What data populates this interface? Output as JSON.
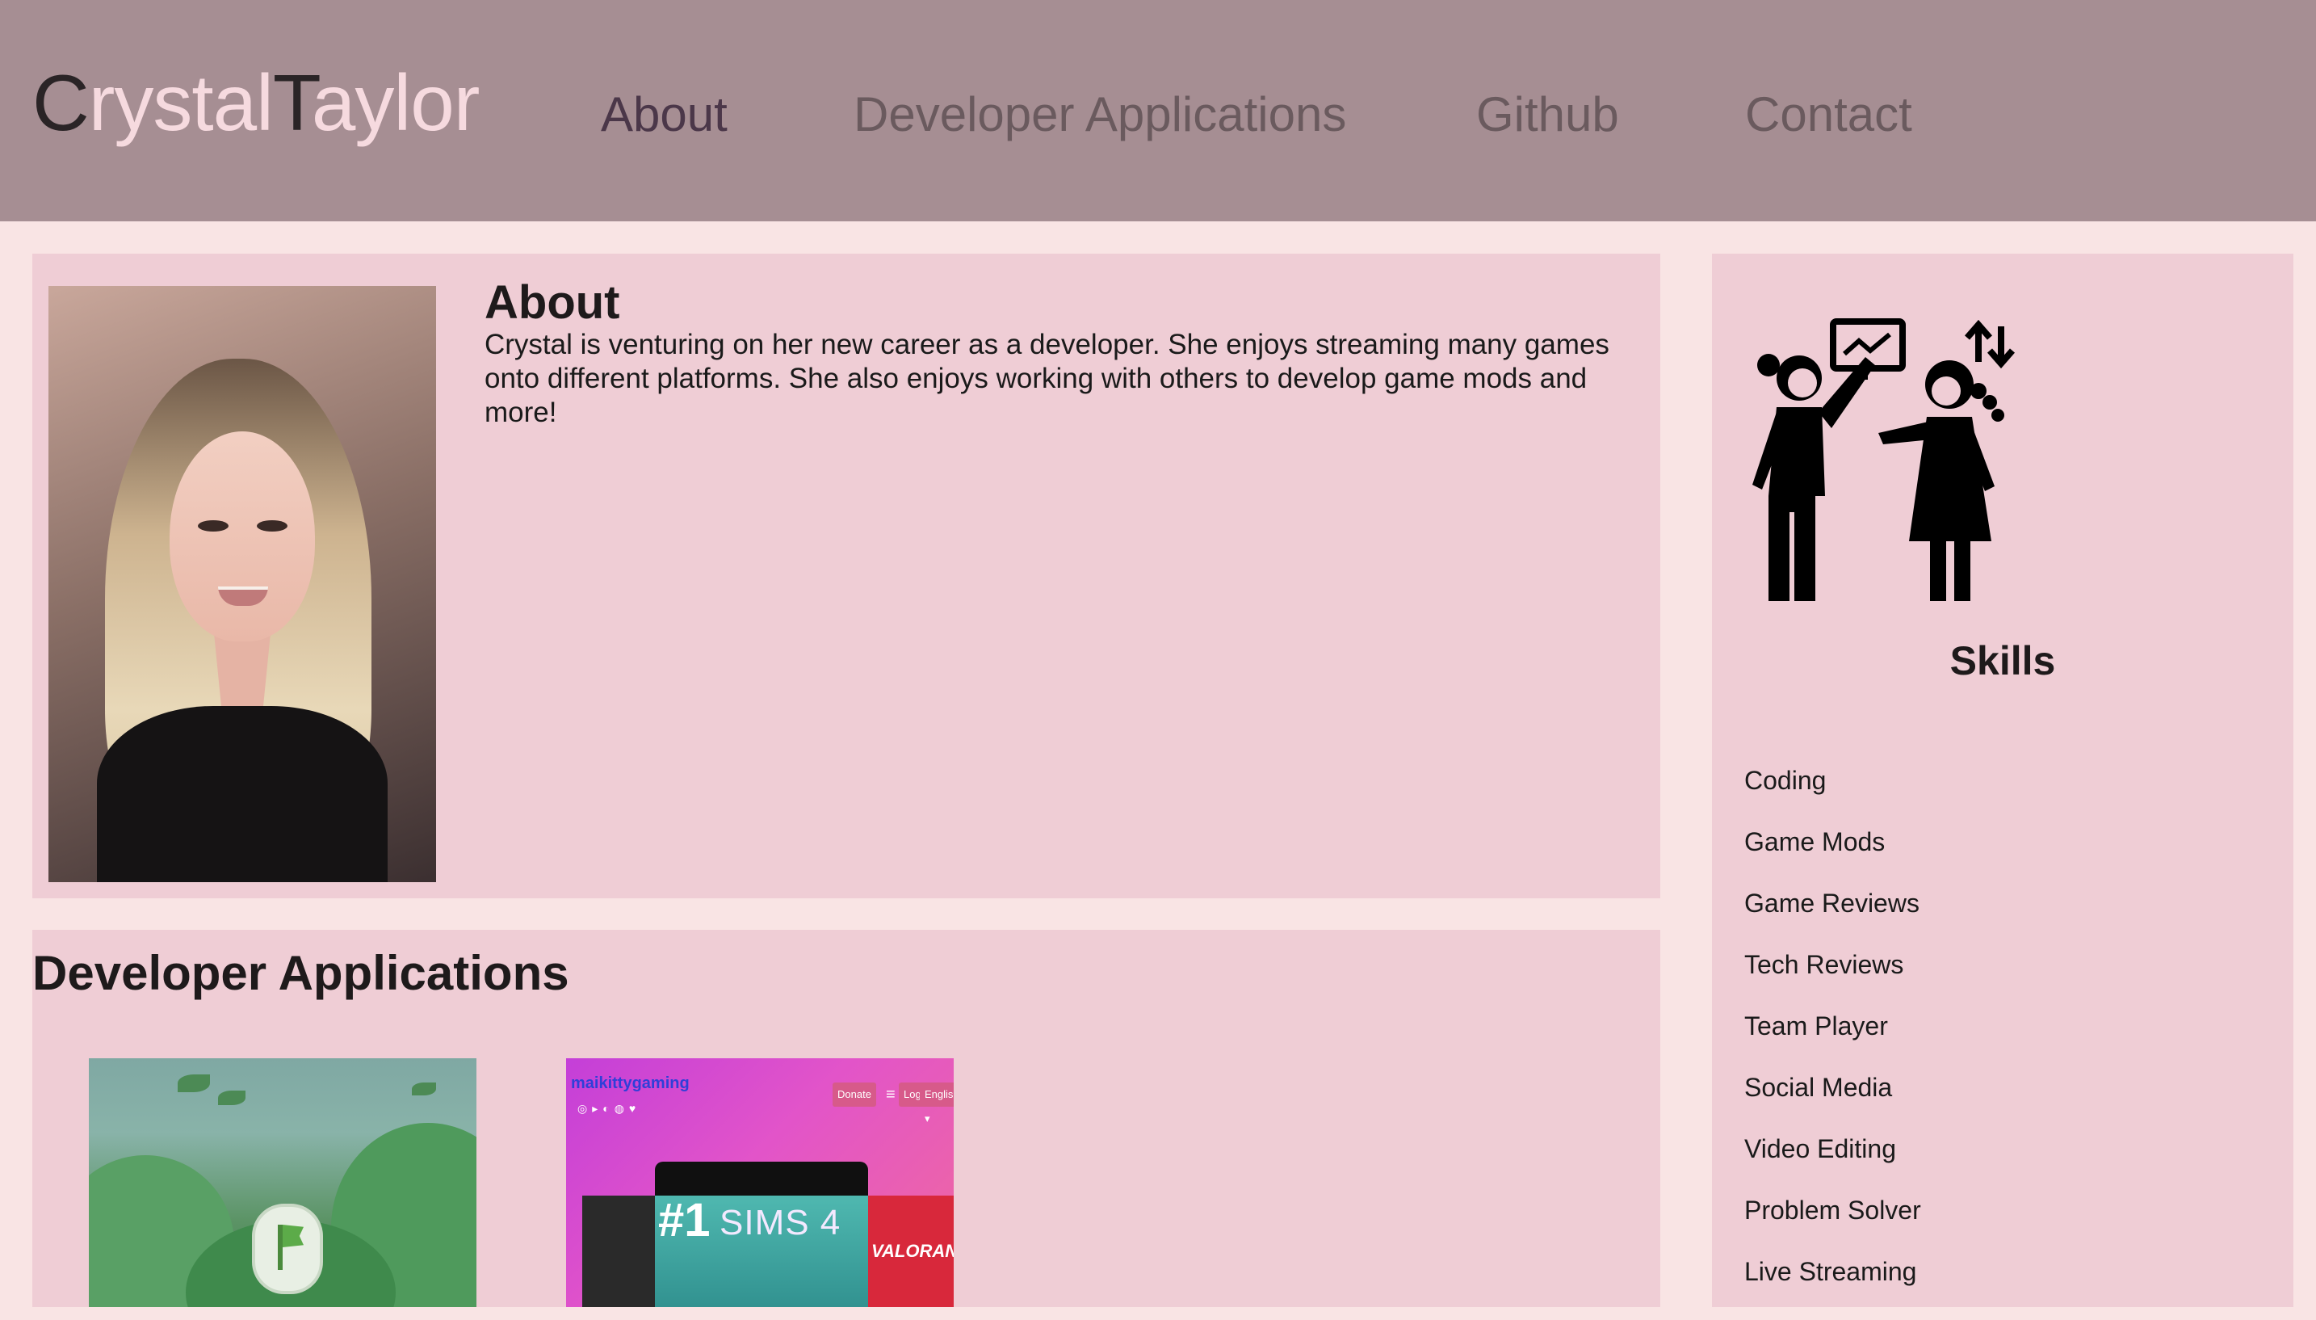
{
  "header": {
    "brand": {
      "first_initial": "C",
      "first_rest": "rystal",
      "last_initial": "T",
      "last_rest": "aylor"
    },
    "nav": [
      {
        "label": "About",
        "active": true
      },
      {
        "label": "Developer Applications",
        "active": false
      },
      {
        "label": "Github",
        "active": false
      },
      {
        "label": "Contact",
        "active": false
      }
    ]
  },
  "about": {
    "title": "About",
    "text": "Crystal is venturing on her new career as a developer. She enjoys streaming many games onto different platforms. She also enjoys working with others to develop game mods and more!"
  },
  "developer_applications": {
    "title": "Developer Applications",
    "apps": [
      {
        "thumbnail": "game-scene-with-green-flag"
      },
      {
        "thumbnail": "streaming-site",
        "logo_text": "maikittygaming",
        "buttons": [
          "Donate",
          "≡",
          "Login",
          "English ▾"
        ],
        "rank_text": "#1",
        "game_text": "SIMS 4",
        "side_text": "VALORANT"
      }
    ]
  },
  "skills": {
    "title": "Skills",
    "items": [
      "Coding",
      "Game Mods",
      "Game Reviews",
      "Tech Reviews",
      "Team Player",
      "Social Media",
      "Video Editing",
      "Problem Solver",
      "Live Streaming"
    ]
  },
  "colors": {
    "header_bg": "#a68e93",
    "page_bg": "#f9e4e4",
    "panel_bg": "#efcdd5",
    "brand_dark": "#2a2426",
    "brand_light": "#f6dadf",
    "nav_active": "#4b3749",
    "nav_inactive": "#6a5a5e"
  }
}
